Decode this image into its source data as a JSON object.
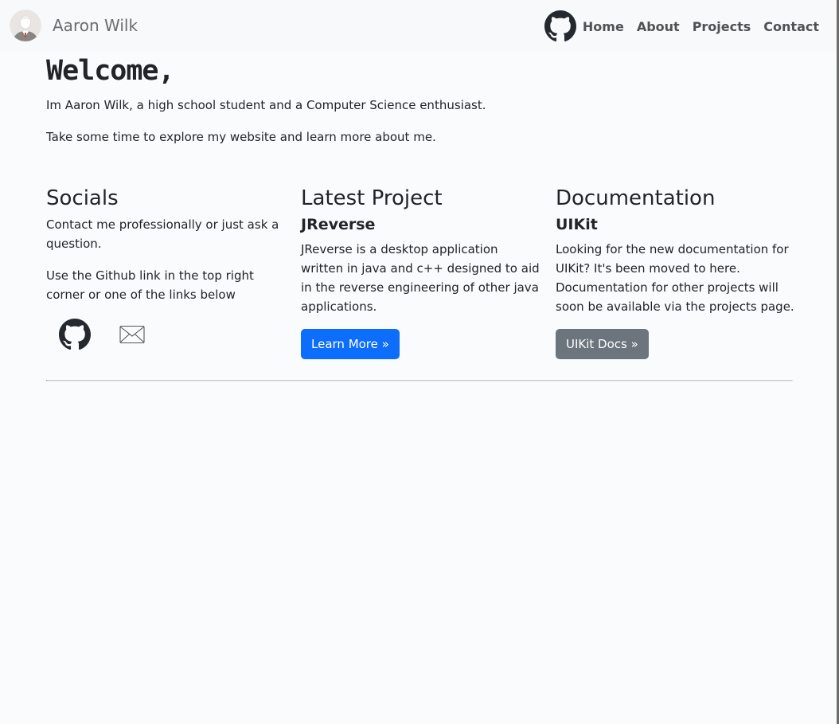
{
  "navbar": {
    "brand_name": "Aaron Wilk",
    "links": [
      {
        "label": "Home"
      },
      {
        "label": "About"
      },
      {
        "label": "Projects"
      },
      {
        "label": "Contact"
      }
    ]
  },
  "intro": {
    "heading": "Welcome,",
    "line1": "Im Aaron Wilk, a high school student and a Computer Science enthusiast.",
    "line2": "Take some time to explore my website and learn more about me."
  },
  "socials": {
    "title": "Socials",
    "text1": "Contact me professionally or just ask a question.",
    "text2": "Use the Github link in the top right corner or one of the links below"
  },
  "latest_project": {
    "title": "Latest Project",
    "name": "JReverse",
    "description": "JReverse is a desktop application written in java and c++ designed to aid in the reverse engineering of other java applications.",
    "button_label": "Learn More »"
  },
  "documentation": {
    "title": "Documentation",
    "name": "UIKit",
    "description": "Looking for the new documentation for UIKit? It's been moved to here. Documentation for other projects will soon be available via the projects page.",
    "button_label": "UIKit Docs »"
  },
  "icons": {
    "nav_github": "github-icon",
    "social_github": "github-icon",
    "social_mail": "mail-icon",
    "avatar": "avatar"
  },
  "colors": {
    "primary": "#0d6efd",
    "secondary": "#6c757d",
    "navbar_bg": "#f8f9fa"
  }
}
